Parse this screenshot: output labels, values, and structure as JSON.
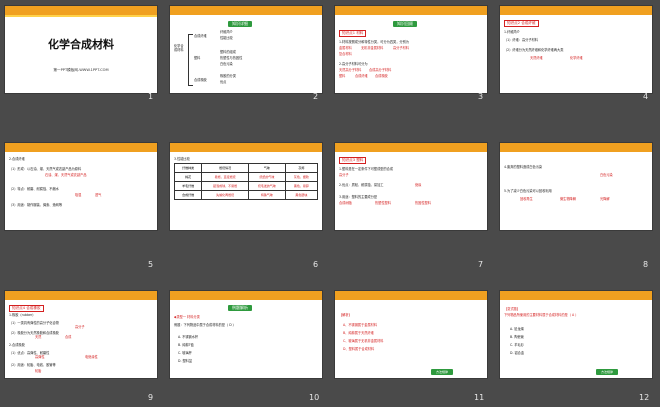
{
  "slides": [
    {
      "num": "1",
      "title": "化学合成材料",
      "footer": "第一PPT模板网-WWW.1PPT.COM"
    },
    {
      "num": "2",
      "tag": "知识详细",
      "left": "化学合成材料",
      "b1": "合成纤维",
      "b1a": "纤维简介",
      "b1b": "性能比较",
      "b2": "塑料",
      "b2a": "塑料的组成",
      "b2b": "热塑性与热固性",
      "b2c": "白色污染",
      "b3": "合成橡胶",
      "b3a": "橡胶的分类",
      "b3b": "优点"
    },
    {
      "num": "3",
      "tag": "知识回顾",
      "h": "知识点1 材料",
      "l1": "1.材料按照成分和特性分类，可分为四类，分别为",
      "l1a": "金属材料",
      "l1b": "无机非金属材料",
      "l1c": "高分子材料",
      "l1d": "复合材料",
      "l2": "2.高分子材料可分为",
      "l2a": "天然高分子材料",
      "l2b": "合成高分子材料",
      "l2c": "塑料",
      "l2d": "合成纤维",
      "l2e": "合成橡胶"
    },
    {
      "num": "4",
      "h": "知识点2 合成纤维",
      "l1": "1.纤维简介",
      "l2": "（1）纤维：高分子材料",
      "l3": "（2）纤维分为天然纤维和化学纤维两大类",
      "l4": "天然纤维",
      "l5": "化学纤维"
    },
    {
      "num": "5",
      "h": "2.合成纤维",
      "l1": "（1）形成：以石油、煤、天然气或农副产品为原料",
      "l1a": "石油、煤、天然气或农副产品",
      "l2": "（2）特点：耐磨、耐腐蚀、不缩水",
      "l2a": "吸湿",
      "l2b": "透气",
      "l3": "（3）用途：制作服装、绳索、渔网等"
    },
    {
      "num": "6",
      "h": "3.性能比较",
      "headers": [
        "纤维种类",
        "燃烧情况",
        "气味",
        "灰烬"
      ],
      "rows": [
        [
          "棉花",
          "易燃，直接燃烧",
          "烧纸的气味",
          "灰色，细软"
        ],
        [
          "羊毛纤维",
          "起泡成球，不易燃",
          "烧毛发的气味",
          "黑色，易碎"
        ],
        [
          "合成纤维",
          "先熔化再燃烧",
          "特殊气味",
          "黑色硬块"
        ]
      ]
    },
    {
      "num": "7",
      "h": "知识点3 塑料",
      "l1": "1.塑料是在一定条件下可塑成型的合成",
      "l1a": "高分子",
      "l2": "2.优点：质轻、耐腐蚀、易加工",
      "l2a": "绝缘",
      "l3": "3.用途：塑料的主要成分是",
      "l3a": "合成树脂",
      "l3b": "热塑性塑料",
      "l3c": "热固性塑料"
    },
    {
      "num": "8",
      "l1": "4.废弃的塑料造成白色污染",
      "l1a": "白色污染",
      "l2": "5.为了减少白色污染可以回收利用",
      "l2a": "回收再生",
      "l2b": "微生物降解",
      "l2c": "光降解"
    },
    {
      "num": "9",
      "h": "知识点4 合成橡胶",
      "l1": "1.橡胶（rubber）",
      "l2": "（1）一类具有弹性的高分子化合物",
      "l2a": "高分子",
      "l3": "（2）橡胶分为天然橡胶和合成橡胶",
      "l3a": "天然",
      "l3b": "合成",
      "l4": "2.合成橡胶",
      "l5": "（1）优点：高弹性、耐磨性",
      "l5a": "高弹性",
      "l5b": "电绝缘性",
      "l6": "（2）用途：轮胎、电线、胶管等",
      "l6a": "轮胎"
    },
    {
      "num": "10",
      "tag": "例题解析",
      "h": "◆类型一 材料分类",
      "q": "例题：下列物品中属于合成材料的是（ D ）",
      "a": "A. 不锈钢水杯",
      "b": "B. 纯棉T恤",
      "c": "C. 玻璃杯",
      "d": "D. 塑料盆"
    },
    {
      "num": "11",
      "h": "【解析】",
      "a": "A、不锈钢属于金属材料",
      "b": "B、纯棉属于天然纤维",
      "c": "C、玻璃属于无机非金属材料",
      "d": "D、塑料属于合成材料",
      "btn": "方法规律"
    },
    {
      "num": "12",
      "h": "【变式题】",
      "q": "下列物品所使用的主要材料属于合成材料的是（ A ）",
      "a": "A. 尼龙绳",
      "b": "B. 陶瓷碗",
      "c": "C. 羊毛衫",
      "d": "D. 铝合金",
      "btn": "方法规律"
    }
  ]
}
